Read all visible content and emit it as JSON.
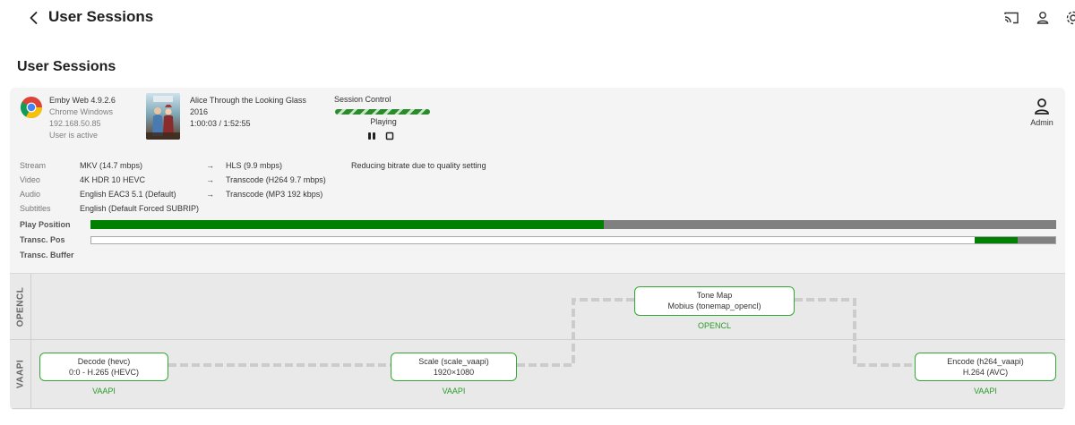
{
  "header": {
    "title": "User Sessions",
    "icons": [
      "cast-icon",
      "user-icon",
      "settings-icon"
    ]
  },
  "section_title": "User Sessions",
  "session": {
    "client": {
      "app": "Emby Web 4.9.2.6",
      "device": "Chrome Windows",
      "ip": "192.168.50.85",
      "status": "User is active",
      "icon": "chrome-icon"
    },
    "media": {
      "title": "Alice Through the Looking Glass",
      "year": "2016",
      "position": "1:00:03 / 1:52:55"
    },
    "control": {
      "label": "Session Control",
      "state": "Playing"
    },
    "user": {
      "name": "Admin"
    },
    "info": [
      {
        "key": "Stream",
        "source": "MKV (14.7 mbps)",
        "arrow": "→",
        "target": "HLS (9.9 mbps)",
        "note": "Reducing bitrate due to quality setting"
      },
      {
        "key": "Video",
        "source": "4K HDR 10 HEVC",
        "arrow": "→",
        "target": "Transcode (H264 9.7 mbps)",
        "note": ""
      },
      {
        "key": "Audio",
        "source": "English EAC3 5.1 (Default)",
        "arrow": "→",
        "target": "Transcode (MP3 192 kbps)",
        "note": ""
      },
      {
        "key": "Subtitles",
        "source": "English (Default Forced SUBRIP)",
        "arrow": "",
        "target": "",
        "note": ""
      }
    ],
    "bars": {
      "play_position_label": "Play Position",
      "transcode_position_label": "Transc. Pos",
      "transcode_buffer_label": "Transc. Buffer",
      "play_fraction": 0.532,
      "transcode_start_fraction": 0.916,
      "transcode_end_fraction": 0.961
    },
    "pipeline": {
      "lanes": [
        "OPENCL",
        "VAAPI"
      ],
      "nodes": [
        {
          "line1": "Decode (hevc)",
          "line2": "0:0 - H.265 (HEVC)",
          "tag": "VAAPI"
        },
        {
          "line1": "Scale (scale_vaapi)",
          "line2": "1920×1080",
          "tag": "VAAPI"
        },
        {
          "line1": "Tone Map",
          "line2": "Mobius (tonemap_opencl)",
          "tag": "OPENCL"
        },
        {
          "line1": "Encode (h264_vaapi)",
          "line2": "H.264 (AVC)",
          "tag": "VAAPI"
        }
      ]
    }
  }
}
